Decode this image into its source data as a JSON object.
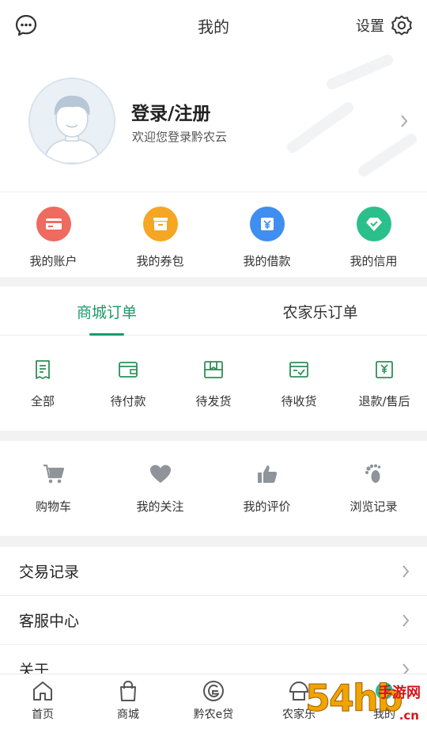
{
  "header": {
    "title": "我的",
    "settings_label": "设置"
  },
  "profile": {
    "name": "登录/注册",
    "subtitle": "欢迎您登录黔农云"
  },
  "wallet": [
    {
      "label": "我的账户",
      "icon": "card-icon",
      "color": "#ef6b5f"
    },
    {
      "label": "我的券包",
      "icon": "coupon-icon",
      "color": "#f5a623"
    },
    {
      "label": "我的借款",
      "icon": "loan-icon",
      "color": "#3f8ef0"
    },
    {
      "label": "我的信用",
      "icon": "credit-icon",
      "color": "#2bbf8c"
    }
  ],
  "orders": {
    "tabs": [
      "商城订单",
      "农家乐订单"
    ],
    "items": [
      {
        "label": "全部",
        "icon": "receipt-icon"
      },
      {
        "label": "待付款",
        "icon": "wallet-icon"
      },
      {
        "label": "待发货",
        "icon": "package-icon"
      },
      {
        "label": "待收货",
        "icon": "truck-icon"
      },
      {
        "label": "退款/售后",
        "icon": "refund-icon"
      }
    ]
  },
  "shortcuts": [
    {
      "label": "购物车",
      "icon": "cart-icon"
    },
    {
      "label": "我的关注",
      "icon": "heart-icon"
    },
    {
      "label": "我的评价",
      "icon": "thumbs-up-icon"
    },
    {
      "label": "浏览记录",
      "icon": "footprint-icon"
    }
  ],
  "list": [
    "交易记录",
    "客服中心",
    "关于"
  ],
  "tabbar": [
    {
      "label": "首页",
      "icon": "home-icon"
    },
    {
      "label": "商城",
      "icon": "shopping-bag-icon"
    },
    {
      "label": "黔农e贷",
      "icon": "e-loan-icon"
    },
    {
      "label": "农家乐",
      "icon": "farmhouse-icon"
    },
    {
      "label": "我的",
      "icon": "profile-icon"
    }
  ],
  "watermark": {
    "digits": "54hb",
    "text": "手游网",
    "site": ".cn"
  },
  "colors": {
    "accent": "#1a9a6a",
    "icon_green": "#2e8f5a",
    "icon_gray": "#8e9499"
  }
}
